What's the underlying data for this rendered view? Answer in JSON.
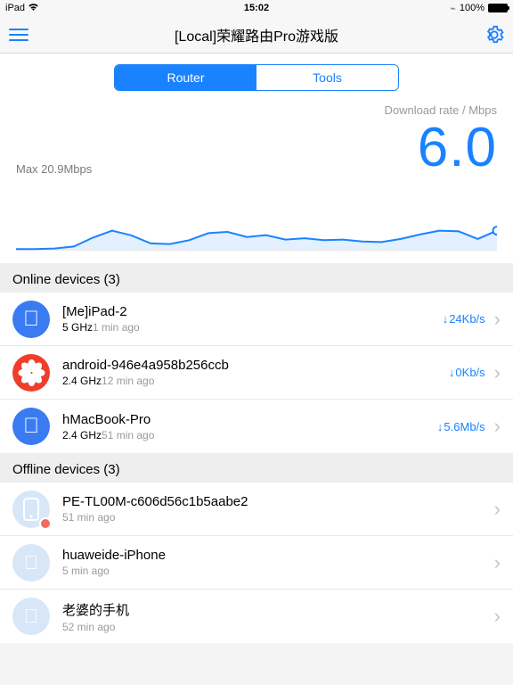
{
  "status": {
    "carrier": "iPad",
    "time": "15:02",
    "battery": "100%"
  },
  "nav": {
    "title": "[Local]荣耀路由Pro游戏版"
  },
  "tabs": {
    "router": "Router",
    "tools": "Tools"
  },
  "rate": {
    "label": "Download rate / Mbps",
    "value": "6.0",
    "max": "Max 20.9Mbps"
  },
  "sections": {
    "online": "Online devices (3)",
    "offline": "Offline devices (3)"
  },
  "online": [
    {
      "name": "[Me]iPad-2",
      "band": "5 GHz",
      "time": "1 min ago",
      "rate": "24Kb/s",
      "icon": "apple-blue"
    },
    {
      "name": "android-946e4a958b256ccb",
      "band": "2.4 GHz",
      "time": "12 min ago",
      "rate": "0Kb/s",
      "icon": "huawei-red"
    },
    {
      "name": "hMacBook-Pro",
      "band": "2.4 GHz",
      "time": "51 min ago",
      "rate": "5.6Mb/s",
      "icon": "apple-blue"
    }
  ],
  "offline": [
    {
      "name": "PE-TL00M-c606d56c1b5aabe2",
      "time": "51 min ago",
      "icon": "faded-phone",
      "badge": true
    },
    {
      "name": "huaweide-iPhone",
      "time": "5 min ago",
      "icon": "faded-apple"
    },
    {
      "name": "老婆的手机",
      "time": "52 min ago",
      "icon": "faded-apple"
    }
  ],
  "chart_data": {
    "type": "area",
    "title": "Download rate / Mbps",
    "xlabel": "",
    "ylabel": "Mbps",
    "ylim": [
      0,
      21
    ],
    "series": [
      {
        "name": "download",
        "values": [
          0.2,
          0.2,
          0.4,
          1.0,
          3.8,
          6.0,
          4.5,
          2.0,
          1.8,
          3.0,
          5.2,
          5.6,
          4.0,
          4.6,
          3.2,
          3.6,
          3.0,
          3.2,
          2.6,
          2.4,
          3.4,
          4.8,
          6.0,
          5.8,
          3.4,
          6.0
        ]
      }
    ],
    "annotations": {
      "max": "Max 20.9Mbps",
      "current": 6.0
    }
  }
}
